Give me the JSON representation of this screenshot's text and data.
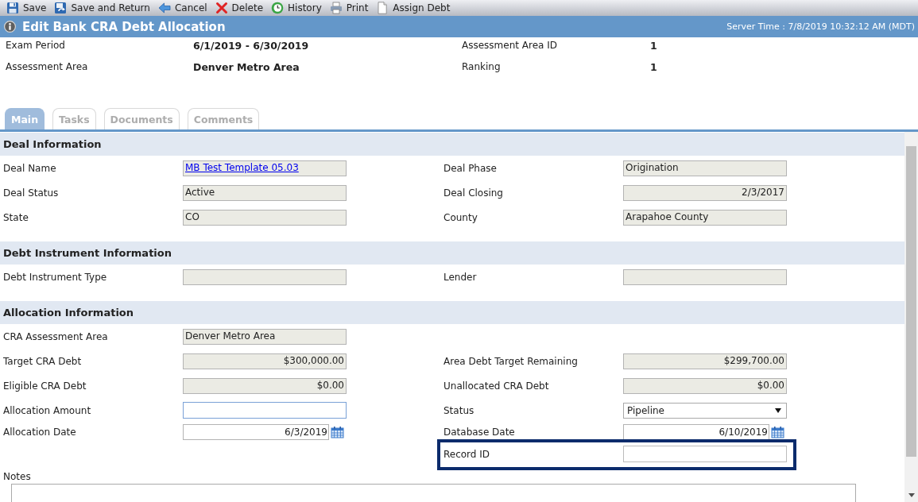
{
  "toolbar": [
    {
      "label": "Save"
    },
    {
      "label": "Save and Return"
    },
    {
      "label": "Cancel"
    },
    {
      "label": "Delete"
    },
    {
      "label": "History"
    },
    {
      "label": "Print"
    },
    {
      "label": "Assign Debt"
    }
  ],
  "title_bar": {
    "title": "Edit Bank CRA Debt Allocation",
    "server_time": "Server Time : 7/8/2019 10:32:12 AM (MDT)"
  },
  "summary": {
    "rows": [
      {
        "cells": [
          {
            "label": "Exam Period",
            "value": "6/1/2019 - 6/30/2019"
          },
          {
            "label": "Assessment Area ID",
            "value": "1"
          }
        ]
      },
      {
        "cells": [
          {
            "label": "Assessment Area",
            "value": "Denver Metro Area"
          },
          {
            "label": "Ranking",
            "value": "1"
          }
        ]
      }
    ]
  },
  "tabs": [
    {
      "label": "Main",
      "selected": true
    },
    {
      "label": "Tasks",
      "selected": false
    },
    {
      "label": "Documents",
      "selected": false
    },
    {
      "label": "Comments",
      "selected": false
    }
  ],
  "sections": [
    {
      "title": "Deal Information",
      "rows": [
        {
          "left": {
            "label": "Deal Name",
            "highlighted": false,
            "field": {
              "kind": "readonly_link",
              "value": "MB Test Template 05.03"
            }
          },
          "right": {
            "label": "Deal Phase",
            "highlighted": false,
            "field": {
              "kind": "readonly_text",
              "value": "Origination"
            }
          }
        },
        {
          "left": {
            "label": "Deal Status",
            "highlighted": false,
            "field": {
              "kind": "readonly_text",
              "value": "Active"
            }
          },
          "right": {
            "label": "Deal Closing",
            "highlighted": false,
            "field": {
              "kind": "readonly_number",
              "value": "2/3/2017"
            }
          }
        },
        {
          "left": {
            "label": "State",
            "highlighted": false,
            "field": {
              "kind": "readonly_text",
              "value": "CO"
            }
          },
          "right": {
            "label": "County",
            "highlighted": false,
            "field": {
              "kind": "readonly_text",
              "value": "Arapahoe County"
            }
          }
        }
      ]
    },
    {
      "title": "Debt Instrument Information",
      "rows": [
        {
          "left": {
            "label": "Debt Instrument Type",
            "highlighted": false,
            "field": {
              "kind": "readonly_text"
            }
          },
          "right": {
            "label": "Lender",
            "highlighted": false,
            "field": {
              "kind": "readonly_text"
            }
          }
        }
      ]
    },
    {
      "title": "Allocation Information",
      "rows": [
        {
          "left": {
            "label": "CRA Assessment Area",
            "highlighted": false,
            "field": {
              "kind": "readonly_text",
              "value": "Denver Metro Area"
            }
          }
        },
        {
          "left": {
            "label": "Target CRA Debt",
            "highlighted": false,
            "field": {
              "kind": "readonly_number",
              "value": "$300,000.00"
            }
          },
          "right": {
            "label": "Area Debt Target Remaining",
            "highlighted": false,
            "field": {
              "kind": "readonly_number",
              "value": "$299,700.00"
            }
          }
        },
        {
          "left": {
            "label": "Eligible CRA Debt",
            "highlighted": false,
            "field": {
              "kind": "readonly_number",
              "value": "$0.00"
            }
          },
          "right": {
            "label": "Unallocated CRA Debt",
            "highlighted": false,
            "field": {
              "kind": "readonly_number",
              "value": "$0.00"
            }
          }
        },
        {
          "left": {
            "label": "Allocation Amount",
            "highlighted": false,
            "field": {
              "kind": "input",
              "focused": true
            }
          },
          "right": {
            "label": "Status",
            "highlighted": false,
            "field": {
              "kind": "select",
              "value": "Pipeline"
            }
          }
        },
        {
          "left": {
            "label": "Allocation Date",
            "highlighted": false,
            "field": {
              "kind": "date",
              "value": "6/3/2019"
            }
          },
          "right": {
            "label": "Database Date",
            "highlighted": false,
            "field": {
              "kind": "date",
              "value": "6/10/2019"
            }
          }
        },
        {
          "right": {
            "label": "Record ID",
            "highlighted": true,
            "field": {
              "kind": "input",
              "focused": false
            }
          }
        }
      ]
    }
  ],
  "notes": {
    "label": "Notes"
  }
}
